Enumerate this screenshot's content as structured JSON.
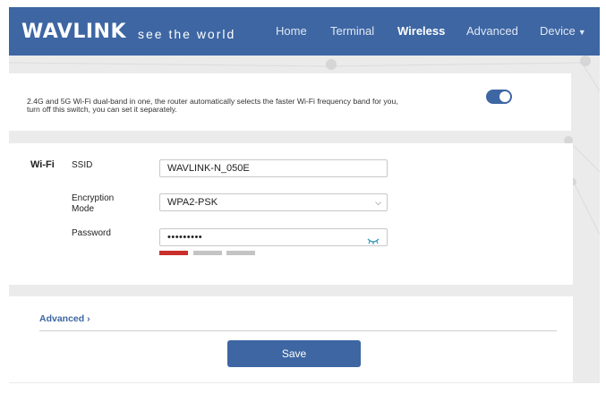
{
  "brand": {
    "logo": "WAVLINK",
    "tagline": "see the world"
  },
  "nav": {
    "home": "Home",
    "terminal": "Terminal",
    "wireless": "Wireless",
    "advanced": "Advanced",
    "device": "Device"
  },
  "dualband": {
    "description_line1": "2.4G and 5G Wi-Fi dual-band in one, the router automatically selects the faster Wi-Fi frequency band for you,",
    "description_line2": "turn off this switch, you can set it separately.",
    "enabled": true
  },
  "wifi": {
    "section_title": "Wi-Fi",
    "ssid_label": "SSID",
    "ssid_value": "WAVLINK-N_050E",
    "encryption_label_line1": "Encryption",
    "encryption_label_line2": "Mode",
    "encryption_value": "WPA2-PSK",
    "password_label": "Password",
    "password_masked": "•••••••••",
    "password_strength_level": 1,
    "password_strength_colors": [
      "#c9302c",
      "#c4c4c4",
      "#c4c4c4"
    ]
  },
  "footer": {
    "advanced_link": "Advanced",
    "save_label": "Save"
  },
  "colors": {
    "brand_blue": "#3d66a3",
    "strength_weak": "#c9302c"
  },
  "icons": {
    "eye": "eye-closed-icon",
    "dropdown": "chevron-down-icon",
    "advanced": "chevron-right-icon"
  }
}
